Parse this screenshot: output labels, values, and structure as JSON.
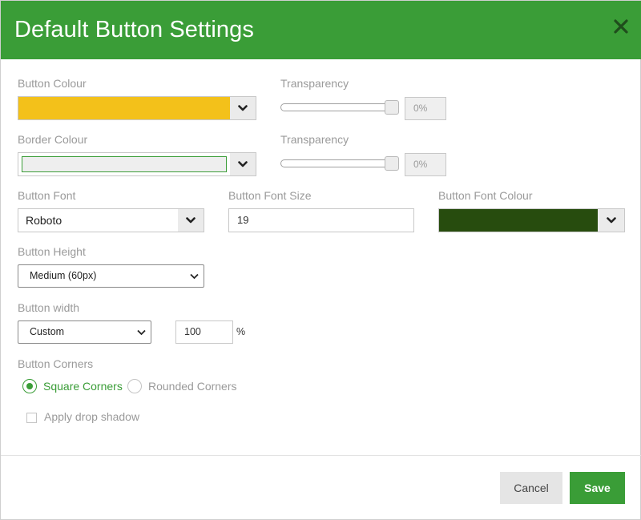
{
  "dialog": {
    "title": "Default Button Settings"
  },
  "button_colour": {
    "label": "Button Colour",
    "color": "#f3c11a"
  },
  "button_transparency": {
    "label": "Transparency",
    "value": "0%",
    "level_fraction": 1.0
  },
  "border_colour": {
    "label": "Border Colour",
    "color": "#eeeeee",
    "inner_border_color": "#3a9d37"
  },
  "border_transparency": {
    "label": "Transparency",
    "value": "0%",
    "level_fraction": 1.0
  },
  "button_font": {
    "label": "Button Font",
    "value": "Roboto"
  },
  "button_font_size": {
    "label": "Button Font Size",
    "value": "19"
  },
  "button_font_colour": {
    "label": "Button Font Colour",
    "color": "#274c0e"
  },
  "button_height": {
    "label": "Button Height",
    "selected": "Medium (60px)"
  },
  "button_width": {
    "label": "Button width",
    "selected": "Custom",
    "value": "100",
    "unit": "%"
  },
  "button_corners": {
    "label": "Button Corners",
    "options": [
      {
        "label": "Square Corners",
        "selected": true
      },
      {
        "label": "Rounded Corners",
        "selected": false
      }
    ]
  },
  "drop_shadow": {
    "label": "Apply drop shadow",
    "checked": false
  },
  "footer": {
    "cancel_label": "Cancel",
    "save_label": "Save"
  },
  "colors": {
    "accent": "#3a9d37",
    "label_grey": "#9a9a9a"
  },
  "icons": {
    "close": "close-icon",
    "dropdown": "chevron-down-icon"
  }
}
